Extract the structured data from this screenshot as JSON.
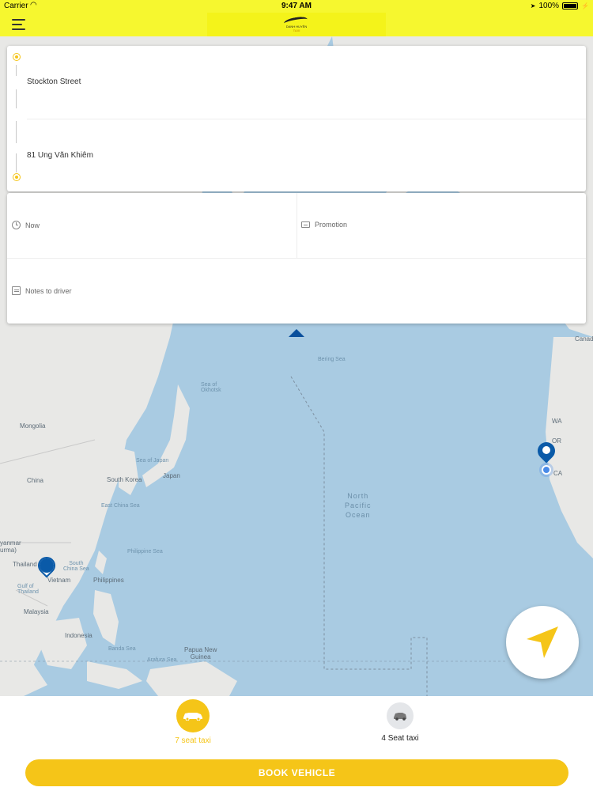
{
  "status_bar": {
    "carrier": "Carrier",
    "time": "9:47 AM",
    "battery": "100%"
  },
  "nav": {
    "logo_text": "DANH HUYÊN",
    "logo_sub": "TAXI"
  },
  "route": {
    "pickup": "Stockton Street",
    "dropoff": "81 Ung Văn Khiêm"
  },
  "options": {
    "time": "Now",
    "promotion": "Promotion",
    "notes": "Notes to driver"
  },
  "map_labels": {
    "canada": "Canad",
    "sea_of_okhotsk": "Sea of\nOkhotsk",
    "bering_sea": "Bering Sea",
    "mongolia": "Mongolia",
    "sea_of_japan": "Sea of Japan",
    "japan": "Japan",
    "south_korea": "South Korea",
    "china": "China",
    "east_china_sea": "East China Sea",
    "philippine_sea": "Philippine Sea",
    "myanmar": "yanmar\nurma)",
    "thailand": "Thailand",
    "south_china_sea": "South\nChina Sea",
    "vietnam": "Vietnam",
    "philippines": "Philippines",
    "gulf_of_thailand": "Gulf of\nThailand",
    "malaysia": "Malaysia",
    "indonesia": "Indonesia",
    "banda_sea": "Banda Sea",
    "arafura_sea": "Arafura Sea",
    "papua_new_guinea": "Papua New\nGuinea",
    "north_pacific_ocean": "North\nPacific\nOcean",
    "wa": "WA",
    "or": "OR",
    "ca": "CA"
  },
  "vehicles": [
    {
      "label": "7 seat taxi",
      "selected": true
    },
    {
      "label": "4 Seat taxi",
      "selected": false
    }
  ],
  "book_button": "BOOK VEHICLE",
  "colors": {
    "header": "#f6f72f",
    "accent": "#f5c518",
    "map_water": "#a9cbe2",
    "map_land": "#e8e8e6",
    "pin": "#0a5aa8"
  },
  "icons": {
    "menu": "menu-icon",
    "clock": "clock-icon",
    "promotion": "ticket-icon",
    "notes": "note-icon",
    "locate": "navigation-arrow-icon",
    "car": "car-icon"
  }
}
